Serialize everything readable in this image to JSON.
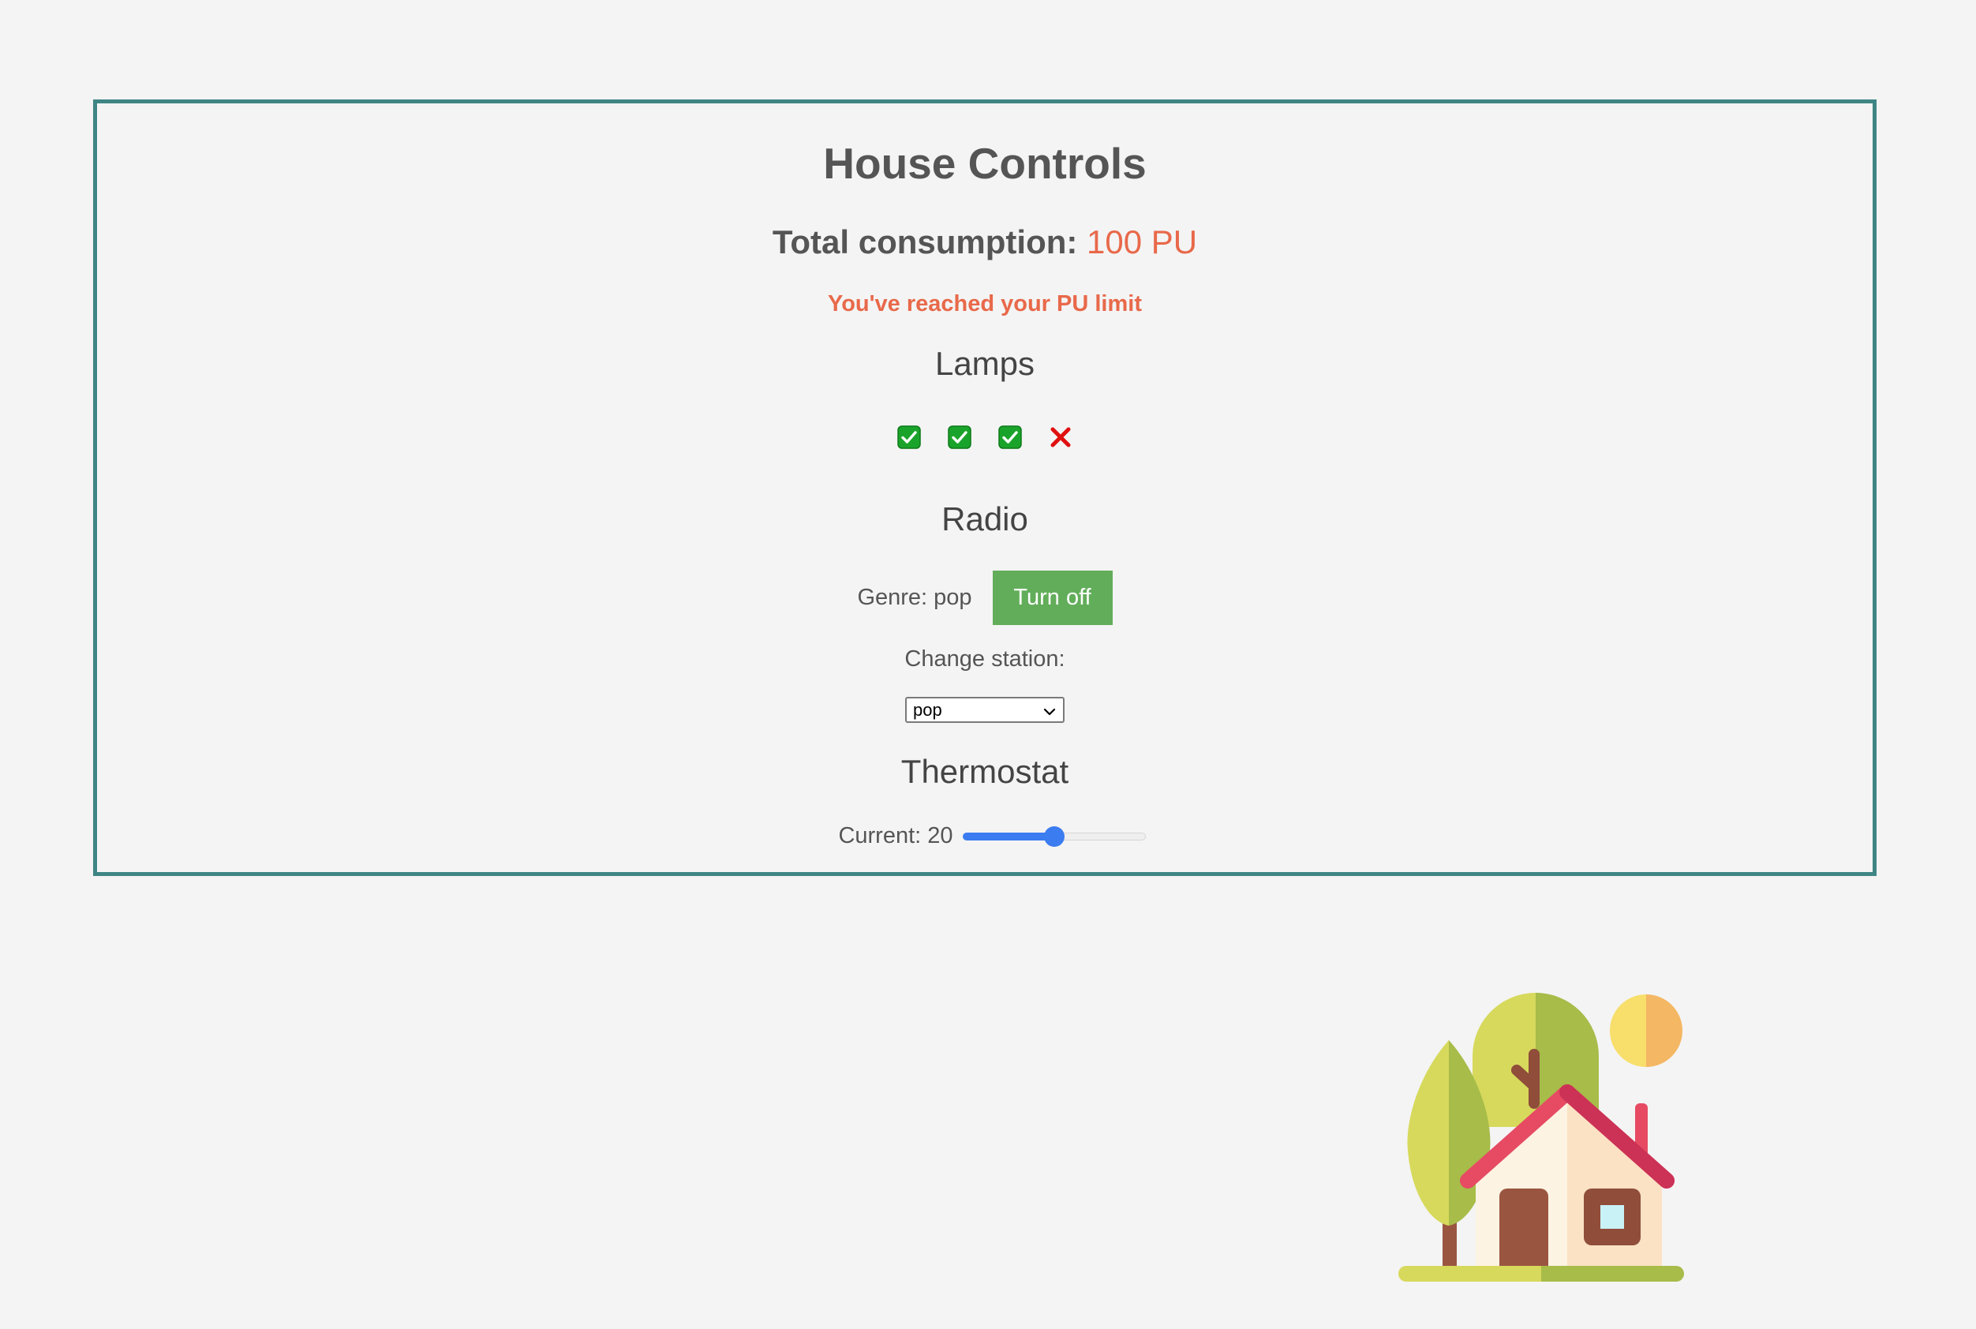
{
  "header": {
    "title": "House Controls",
    "consumption_label": "Total consumption:",
    "consumption_value": "100 PU",
    "limit_warning": "You've reached your PU limit"
  },
  "lamps": {
    "title": "Lamps",
    "states": [
      "on",
      "on",
      "on",
      "off"
    ],
    "icons": [
      "check-mark-icon",
      "check-mark-icon",
      "check-mark-icon",
      "cross-mark-icon"
    ]
  },
  "radio": {
    "title": "Radio",
    "genre_text": "Genre: pop",
    "toggle_label": "Turn off",
    "station_label": "Change station:",
    "station_selected": "pop"
  },
  "thermostat": {
    "title": "Thermostat",
    "current_text": "Current: 20",
    "value": 20,
    "fraction": 0.5
  },
  "colors": {
    "accent_border": "#3f8585",
    "warning": "#e8694a",
    "button": "#62ad5a",
    "slider": "#3b7cf0",
    "check": "#1aa32a",
    "cross": "#e01010"
  },
  "illustration": {
    "icon": "house-with-trees-illustration"
  }
}
